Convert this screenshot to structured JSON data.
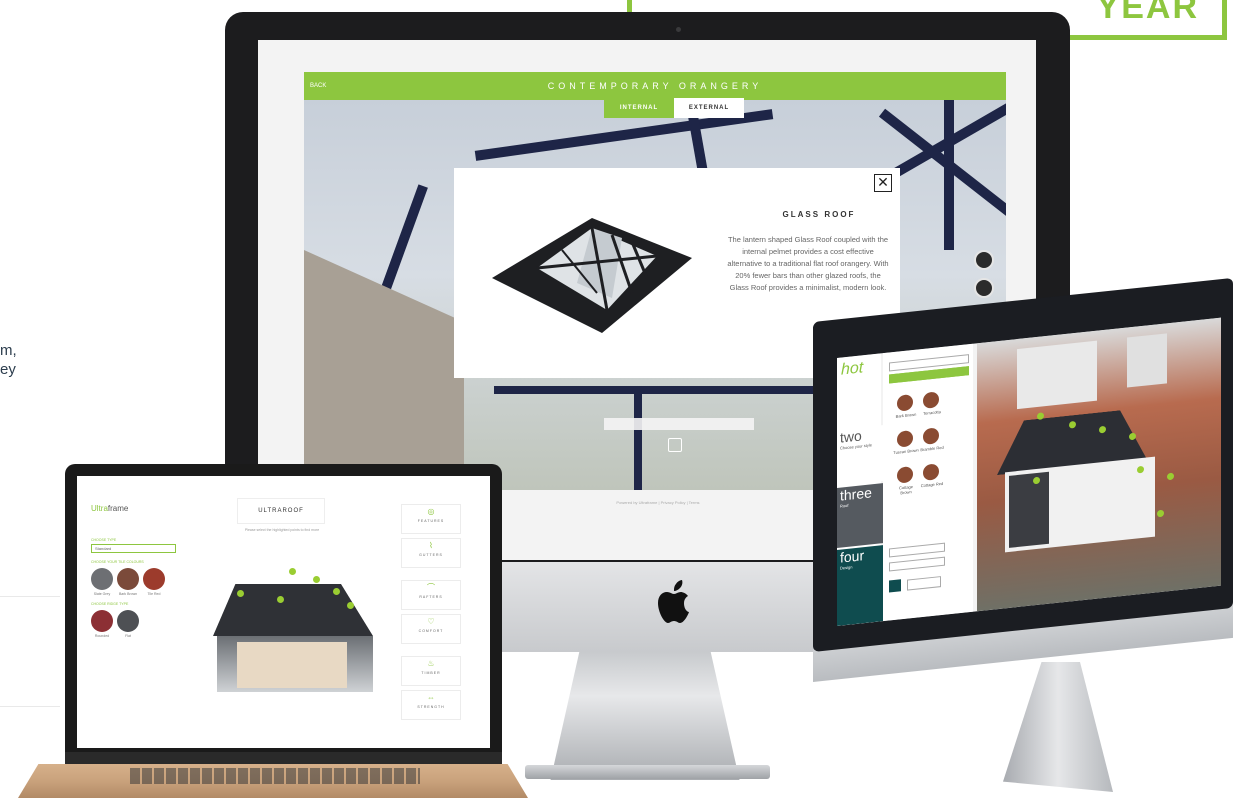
{
  "banner": {
    "text": "YEAR"
  },
  "side_text": {
    "lines": [
      "m,",
      "ey"
    ]
  },
  "imac": {
    "header_title": "CONTEMPORARY ORANGERY",
    "header_small": "BACK",
    "tabs": [
      {
        "label": "INTERNAL",
        "active": true
      },
      {
        "label": "EXTERNAL",
        "active": false
      }
    ],
    "modal": {
      "title": "GLASS ROOF",
      "description": "The lantern shaped Glass Roof coupled with the internal pelmet provides a cost effective alternative to a traditional flat roof orangery. With 20% fewer bars than other glazed roofs, the Glass Roof provides a minimalist, modern look.",
      "close_symbol": "✕"
    },
    "footer": "Powered by Ultraframe | Privacy Policy | Terms"
  },
  "monitor": {
    "steps": [
      {
        "label": "two",
        "sub": "Choose your style"
      },
      {
        "label": "three",
        "sub": "Roof"
      },
      {
        "label": "four",
        "sub": "Design"
      }
    ],
    "swatches": [
      {
        "label": "Bark Brown",
        "color": "#8a4b32"
      },
      {
        "label": "Terracotta",
        "color": "#8a4b32"
      },
      {
        "label": "Tuscan Brown",
        "color": "#7e4630"
      },
      {
        "label": "Bramble Red",
        "color": "#8c4e35"
      },
      {
        "label": "Cottage Brown",
        "color": "#8a4b32"
      },
      {
        "label": "Cottage Red",
        "color": "#8a4b32"
      }
    ]
  },
  "laptop": {
    "logo_a": "Ultra",
    "logo_b": "frame",
    "label_choose": "CHOOSE TYPE",
    "select_value": "Standard",
    "label_tiles": "CHOOSE YOUR TILE COLOURS",
    "label_ridge": "CHOOSE RIDGE TYPE",
    "title": "ULTRAROOF",
    "hint": "Please select the highlighted points to find more",
    "swatches": [
      {
        "label": "Slate Grey",
        "color": "#6d6f73"
      },
      {
        "label": "Bark Brown",
        "color": "#7b4a3a"
      },
      {
        "label": "Tile Red",
        "color": "#9c3b2c"
      }
    ],
    "ridge": [
      {
        "label": "Rounded",
        "color": "#8c2f34"
      },
      {
        "label": "Flat",
        "color": "#4e5054"
      }
    ],
    "nav": [
      {
        "label": "FEATURES",
        "icon": "◎"
      },
      {
        "label": "GUTTERS",
        "icon": "⌇"
      },
      {
        "label": "RAFTERS",
        "icon": "⌒"
      },
      {
        "label": "COMFORT",
        "icon": "♡"
      },
      {
        "label": "TIMBER",
        "icon": "♨"
      },
      {
        "label": "STRENGTH",
        "icon": "⇔"
      }
    ]
  },
  "colors": {
    "brand_green": "#8dc63f",
    "dark_bezel": "#1c1c1e"
  }
}
